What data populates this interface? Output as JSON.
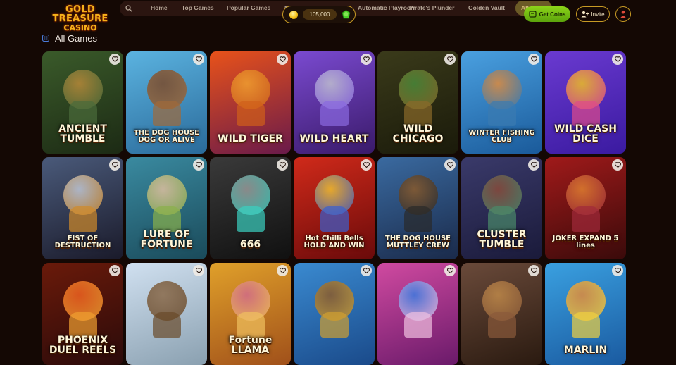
{
  "brand": {
    "line1": "GOLD TREASURE",
    "line2": "CASINO"
  },
  "nav": {
    "search_icon": "search-icon",
    "items": [
      "Home",
      "Top Games",
      "Popular Games",
      "Ne",
      "Automatic Playroom",
      "Pirate's Plunder",
      "Golden Vault",
      "All Games"
    ]
  },
  "wallet": {
    "balance": "105,000",
    "coin_icon": "coin-icon",
    "gem_icon": "gem-icon"
  },
  "actions": {
    "get_coins": "Get Coins",
    "invite": "Invite"
  },
  "section": {
    "title": "All Games",
    "icon": "grid-icon"
  },
  "accent": "#c79a24",
  "games": [
    {
      "name": "ANCIENT TUMBLE",
      "bg": [
        "#3a5a2a",
        "#1c2a14"
      ],
      "c1": "#b98a3a",
      "c2": "#4a6b3a"
    },
    {
      "name": "THE DOG HOUSE DOG OR ALIVE",
      "bg": [
        "#5bb3e0",
        "#2a6a9a"
      ],
      "c1": "#7a4a2a",
      "c2": "#a06a3a"
    },
    {
      "name": "WILD TIGER",
      "bg": [
        "#e8521a",
        "#6a1a4a"
      ],
      "c1": "#f0a030",
      "c2": "#d0601a"
    },
    {
      "name": "WILD HEART",
      "bg": [
        "#7a4ad0",
        "#3a1a6a"
      ],
      "c1": "#c0c0d0",
      "c2": "#8a6ae0"
    },
    {
      "name": "WILD CHICAGO",
      "bg": [
        "#3a3a1a",
        "#1a1a0a"
      ],
      "c1": "#4a8a3a",
      "c2": "#8a6a2a"
    },
    {
      "name": "WINTER FISHING CLUB",
      "bg": [
        "#4aa0e0",
        "#1a5a9a"
      ],
      "c1": "#e08a3a",
      "c2": "#3a7ab0"
    },
    {
      "name": "WILD CASH DICE",
      "bg": [
        "#6a3ad0",
        "#3a1aa0"
      ],
      "c1": "#f0c020",
      "c2": "#e04a8a"
    },
    {
      "name": "FIST OF DESTRUCTION",
      "bg": [
        "#4a5a7a",
        "#1a1a2a"
      ],
      "c1": "#c0c8d8",
      "c2": "#d08a2a"
    },
    {
      "name": "LURE OF FORTUNE",
      "bg": [
        "#3a8aa0",
        "#1a4a5a"
      ],
      "c1": "#e0c0a0",
      "c2": "#8ab04a"
    },
    {
      "name": "666",
      "bg": [
        "#3a3a3a",
        "#101010"
      ],
      "c1": "#9a9a9a",
      "c2": "#3ad0c0"
    },
    {
      "name": "Hot Chilli Bells HOLD AND WIN",
      "bg": [
        "#d02a1a",
        "#6a0a0a"
      ],
      "c1": "#f0c030",
      "c2": "#3a60d0"
    },
    {
      "name": "THE DOG HOUSE MUTTLEY CREW",
      "bg": [
        "#3a6aa0",
        "#1a2a4a"
      ],
      "c1": "#8a5a2a",
      "c2": "#2a2a2a"
    },
    {
      "name": "CLUSTER TUMBLE",
      "bg": [
        "#3a3a6a",
        "#1a1a3a"
      ],
      "c1": "#8a4a3a",
      "c2": "#4a8a6a"
    },
    {
      "name": "JOKER EXPAND 5 lines",
      "bg": [
        "#a01a1a",
        "#3a0a0a"
      ],
      "c1": "#e08030",
      "c2": "#a02a3a"
    },
    {
      "name": "PHOENIX DUEL REELS",
      "bg": [
        "#6a1a0a",
        "#2a0a0a"
      ],
      "c1": "#f06020",
      "c2": "#f0a030"
    },
    {
      "name": "",
      "bg": [
        "#d0e0f0",
        "#8aa0b0"
      ],
      "c1": "#8a6a4a",
      "c2": "#6a4a2a"
    },
    {
      "name": "Fortune LLAMA",
      "bg": [
        "#e0a02a",
        "#a0501a"
      ],
      "c1": "#d06a8a",
      "c2": "#f0c060"
    },
    {
      "name": "",
      "bg": [
        "#3a8ad0",
        "#1a4a8a"
      ],
      "c1": "#8a5a2a",
      "c2": "#d0a030"
    },
    {
      "name": "",
      "bg": [
        "#d04aa0",
        "#6a1a6a"
      ],
      "c1": "#3a7ae0",
      "c2": "#f0c0e0"
    },
    {
      "name": "",
      "bg": [
        "#6a4a3a",
        "#2a1a10"
      ],
      "c1": "#c08a4a",
      "c2": "#8a5a3a"
    },
    {
      "name": "MARLIN",
      "bg": [
        "#3aa0e0",
        "#1a5aa0"
      ],
      "c1": "#e08a3a",
      "c2": "#f0d040"
    }
  ]
}
